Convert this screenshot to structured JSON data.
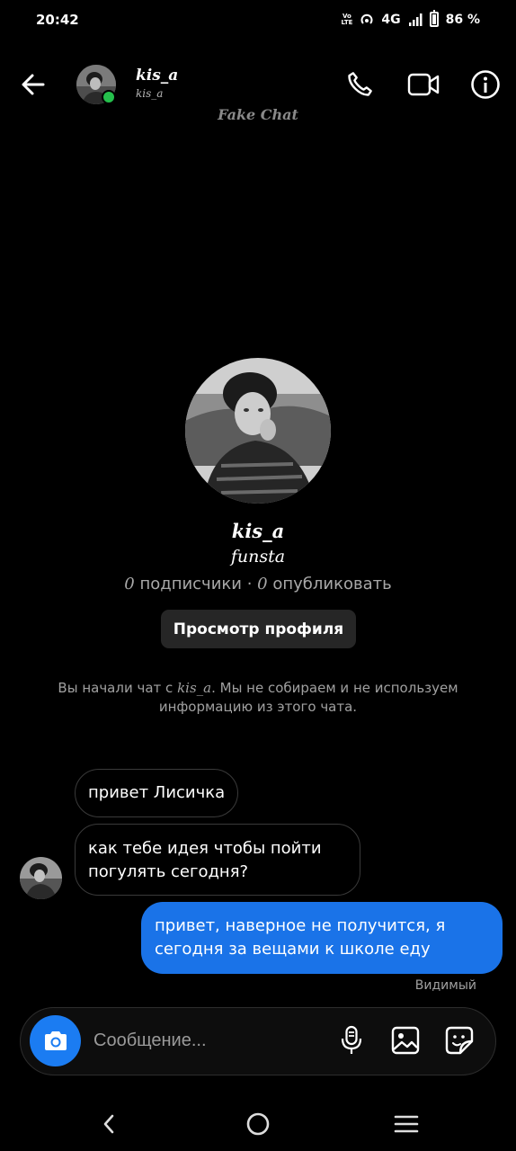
{
  "status_bar": {
    "time": "20:42",
    "volte_top": "Vo",
    "volte_bottom": "LTE",
    "network": "4G",
    "battery": "86 %",
    "icons": [
      "volte-icon",
      "wifi-calling-icon",
      "signal-icon",
      "battery-icon"
    ]
  },
  "header": {
    "name": "kis_a",
    "username": "kis_a",
    "online": true,
    "watermark": "Fake Chat",
    "icons": [
      "back-arrow-icon",
      "phone-icon",
      "video-camera-icon",
      "info-icon"
    ]
  },
  "profile": {
    "name": "kis_a",
    "subtitle": "funsta",
    "followers_count": "0",
    "followers_label": "подписчики",
    "separator": "·",
    "posts_count": "0",
    "posts_label": "опубликовать",
    "view_button": "Просмотр профиля",
    "note_prefix": "Вы начали чат с ",
    "note_user": "kis_a",
    "note_suffix": ". Мы не собираем и не используем информацию из этого чата."
  },
  "messages": [
    {
      "direction": "incoming",
      "text": "привет Лисичка"
    },
    {
      "direction": "incoming",
      "text": "как тебе идея чтобы пойти погулять сегодня?"
    },
    {
      "direction": "outgoing",
      "text": "привет, наверное не получится, я сегодня за вещами к школе еду"
    }
  ],
  "seen_label": "Видимый",
  "composer": {
    "placeholder": "Сообщение...",
    "icons": [
      "camera-icon",
      "microphone-icon",
      "image-icon",
      "sticker-icon"
    ]
  },
  "nav_bar": {
    "icons": [
      "nav-back-icon",
      "nav-home-icon",
      "nav-menu-icon"
    ]
  },
  "colors": {
    "background": "#000000",
    "outgoing_bubble": "#1a73e8",
    "camera_button": "#1b7cf2",
    "online_dot": "#25c04c",
    "button_bg": "#262626"
  }
}
